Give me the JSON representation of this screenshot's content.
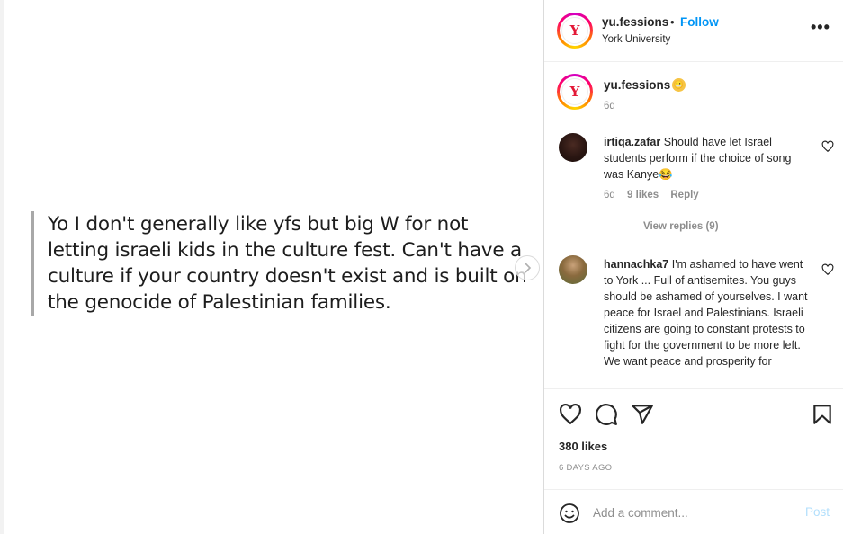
{
  "media": {
    "quote": "Yo I don't generally like yfs but big W for not letting israeli kids in the culture fest. Can't have a culture if your country doesn't exist and is built on the genocide of Palestinian families.",
    "next_icon": "chevron-right-icon"
  },
  "header": {
    "username": "yu.fessions",
    "separator": "•",
    "follow_label": "Follow",
    "location": "York University",
    "more_label": "•••",
    "avatar_letter": "Y"
  },
  "caption": {
    "username": "yu.fessions",
    "emoji": "😬",
    "time": "6d"
  },
  "comments": [
    {
      "username": "irtiqa.zafar",
      "text": "Should have let Israel students perform if the choice of song was Kanye😂",
      "time": "6d",
      "likes": "9 likes",
      "reply_label": "Reply",
      "view_replies": "View replies (9)"
    },
    {
      "username": "hannachka7",
      "text": "I'm ashamed to have went to York ... Full of antisemites. You guys should be ashamed of yourselves. I want peace for Israel and Palestinians. Israeli citizens are going to constant protests to fight for the government to be more left. We want peace and prosperity for"
    }
  ],
  "actions": {
    "likes": "380 likes",
    "time_ago": "6 DAYS AGO"
  },
  "add_comment": {
    "placeholder": "Add a comment...",
    "post_label": "Post"
  },
  "colors": {
    "accent": "#0095f6",
    "muted": "#8e8e8e",
    "post_disabled": "#b2dffc"
  }
}
